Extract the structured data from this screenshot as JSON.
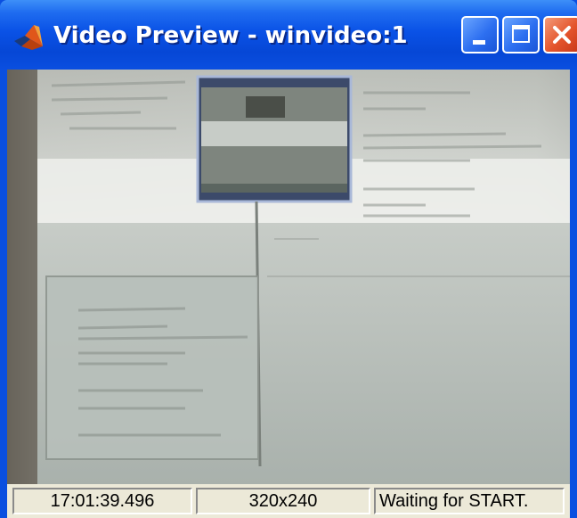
{
  "window": {
    "title": "Video Preview - winvideo:1",
    "icon": "matlab-logo-icon",
    "controls": [
      "minimize-icon",
      "maximize-icon",
      "close-icon"
    ]
  },
  "status_bar": {
    "timestamp": "17:01:39.496",
    "resolution": "320x240",
    "status": "Waiting for START."
  },
  "colors": {
    "title_bar": "#0a4fe0",
    "close_button": "#e4542c",
    "status_bar": "#ece9d8"
  }
}
